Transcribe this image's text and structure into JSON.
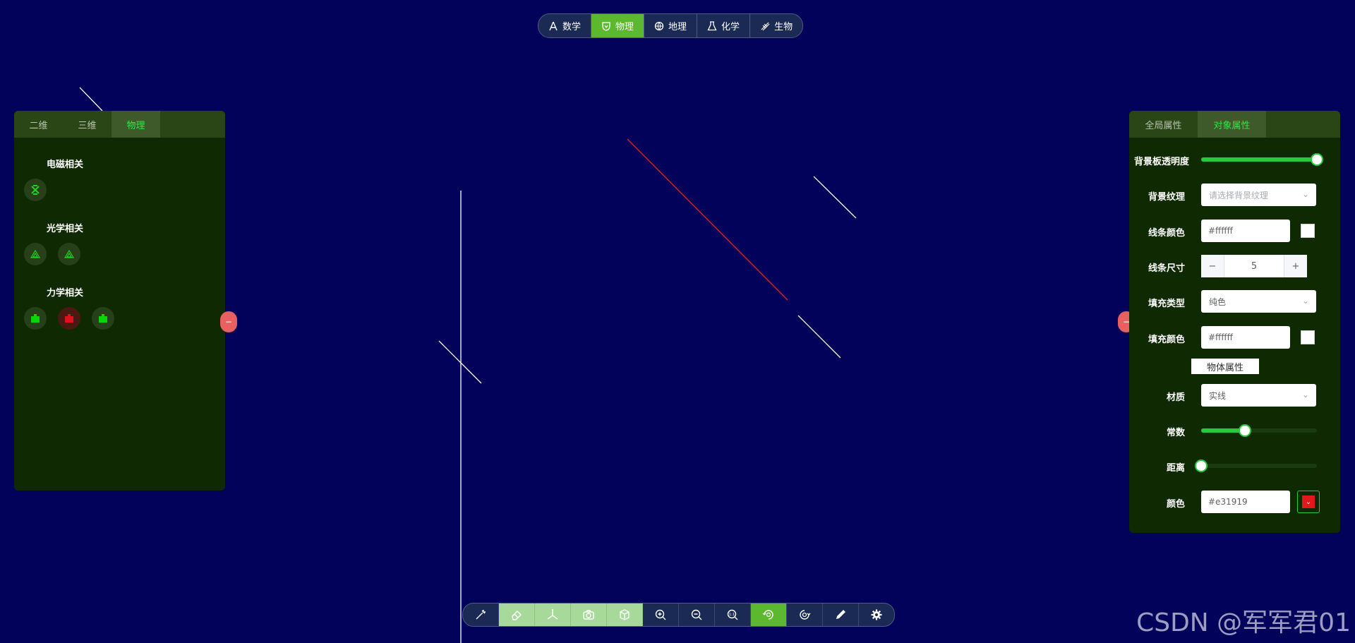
{
  "subjects": [
    {
      "label": "数学",
      "icon": "math-icon",
      "active": false
    },
    {
      "label": "物理",
      "icon": "physics-icon",
      "active": true
    },
    {
      "label": "地理",
      "icon": "globe-icon",
      "active": false
    },
    {
      "label": "化学",
      "icon": "flask-icon",
      "active": false
    },
    {
      "label": "生物",
      "icon": "dna-icon",
      "active": false
    }
  ],
  "left_panel": {
    "tabs": [
      "二维",
      "三维",
      "物理"
    ],
    "active_tab": "物理",
    "sections": [
      {
        "title": "电磁相关",
        "tools": [
          {
            "icon": "magnet-icon",
            "color": "#22d01e"
          }
        ]
      },
      {
        "title": "光学相关",
        "tools": [
          {
            "icon": "prism-icon",
            "color": "#22d01e"
          },
          {
            "icon": "prism-icon",
            "color": "#22d01e"
          }
        ]
      },
      {
        "title": "力学相关",
        "tools": [
          {
            "icon": "weight-block-icon",
            "color": "#08d60a"
          },
          {
            "icon": "weight-block-icon",
            "color": "#e0101e"
          },
          {
            "icon": "weight-block-icon",
            "color": "#08d60a"
          }
        ]
      }
    ]
  },
  "right_panel": {
    "tabs": [
      "全局属性",
      "对象属性"
    ],
    "active_tab": "对象属性",
    "bg_opacity": {
      "label": "背景板透明度",
      "value": 1.0
    },
    "bg_texture": {
      "label": "背景纹理",
      "placeholder": "请选择背景纹理"
    },
    "line_color": {
      "label": "线条颜色",
      "value": "#ffffff"
    },
    "line_size": {
      "label": "线条尺寸",
      "value": "5",
      "minus": "−",
      "plus": "+"
    },
    "fill_type": {
      "label": "填充类型",
      "value": "纯色"
    },
    "fill_color": {
      "label": "填充颜色",
      "value": "#ffffff"
    },
    "object_props_label": "物体属性",
    "material": {
      "label": "材质",
      "value": "实线"
    },
    "constant": {
      "label": "常数",
      "value": 0.38
    },
    "distance": {
      "label": "距离",
      "value": 0.0
    },
    "color": {
      "label": "颜色",
      "value": "#e31919"
    }
  },
  "colors": {
    "background": "#02025a",
    "panel": "#0f2a02",
    "accent_green": "#5cb82e",
    "slider_green": "#25c93b",
    "active_tab_text": "#34e648"
  },
  "bottom_toolbar": [
    {
      "icon": "magic-wand-icon",
      "style": "dark"
    },
    {
      "icon": "eraser-icon",
      "style": "light"
    },
    {
      "icon": "axes-icon",
      "style": "light"
    },
    {
      "icon": "camera-icon",
      "style": "light"
    },
    {
      "icon": "cube-icon",
      "style": "light"
    },
    {
      "icon": "zoom-in-icon",
      "style": "dark"
    },
    {
      "icon": "zoom-out-icon",
      "style": "dark"
    },
    {
      "icon": "zoom-reset-icon",
      "style": "dark"
    },
    {
      "icon": "rotate-icon",
      "style": "green"
    },
    {
      "icon": "rotate-alt-icon",
      "style": "dark"
    },
    {
      "icon": "pencil-icon",
      "style": "dark"
    },
    {
      "icon": "settings-icon",
      "style": "dark"
    }
  ],
  "watermark": "CSDN @军军君01"
}
